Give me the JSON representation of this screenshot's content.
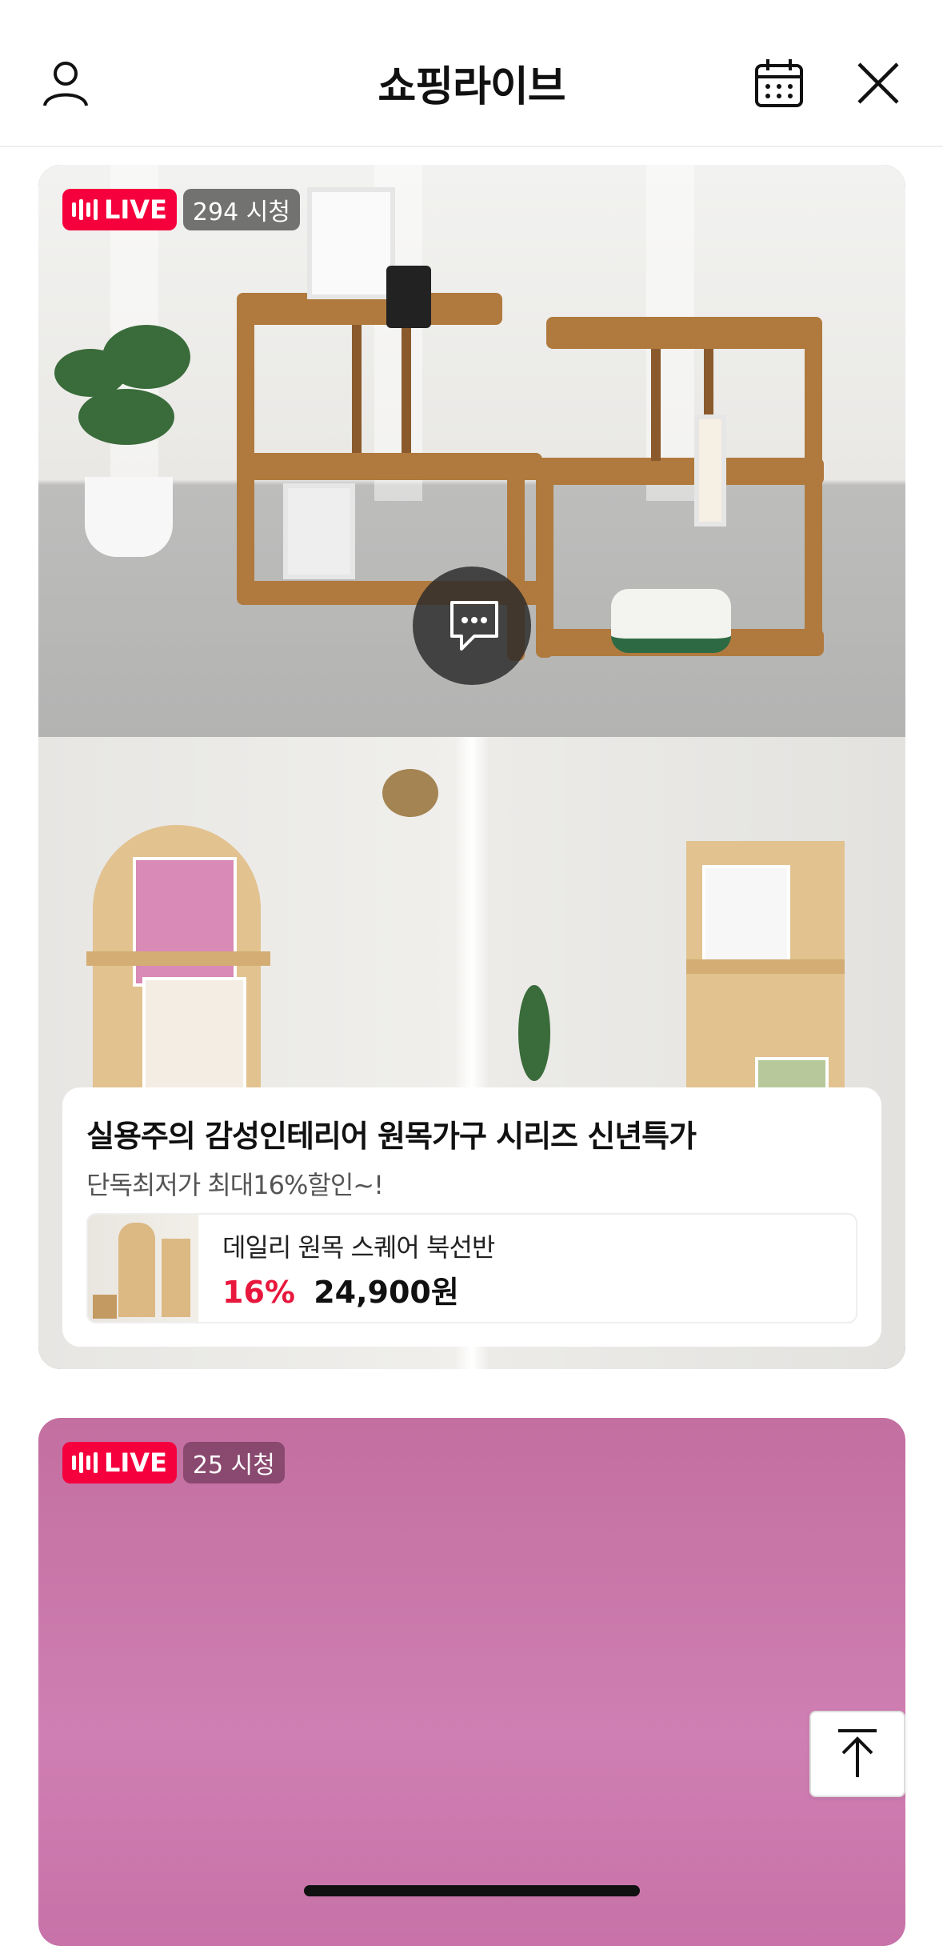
{
  "header": {
    "title": "쇼핑라이브",
    "icons": [
      "user-icon",
      "calendar-icon",
      "close-icon"
    ]
  },
  "broadcasts": [
    {
      "live_label": "LIVE",
      "viewers": "294 시청",
      "title": "실용주의 감성인테리어 원목가구 시리즈 신년특가",
      "subtitle": "단독최저가 최대16%할인~!",
      "product": {
        "name": "데일리 원목 스퀘어 북선반",
        "discount": "16%",
        "price": "24,900원"
      }
    },
    {
      "live_label": "LIVE",
      "viewers": "25 시청"
    }
  ],
  "colors": {
    "live_red": "#f5003d",
    "discount_red": "#e8173d",
    "card2_bg": "#c772a8"
  },
  "controls": {
    "scroll_top_icon": "arrow-up-to-top-icon",
    "chat_icon": "chat-bubble-icon"
  }
}
